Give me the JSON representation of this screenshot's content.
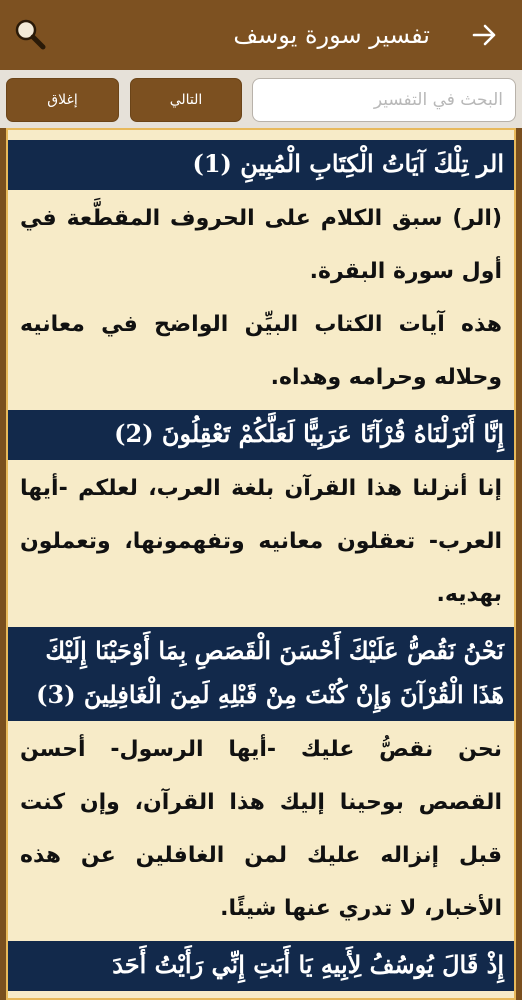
{
  "header": {
    "title": "تفسير سورة يوسف",
    "back_icon": "arrow-right-icon",
    "search_icon": "magnifier-icon",
    "background": "#7d5121"
  },
  "search": {
    "placeholder": "البحث في التفسير",
    "value": "",
    "next_label": "التالي",
    "close_label": "إغلاق"
  },
  "colors": {
    "verse_bg": "#12294b",
    "content_bg": "#f7ebc8",
    "border": "#e8b95b",
    "button_bg": "#7c5020"
  },
  "entries": [
    {
      "verse": "الر تِلْكَ آيَاتُ الْكِتَابِ الْمُبِينِ (1)",
      "tafsir": [
        "(الر) سبق الكلام على الحروف المقطَّعة في أول سورة البقرة.",
        "هذه آيات الكتاب البيِّن الواضح في معانيه وحلاله وحرامه وهداه."
      ]
    },
    {
      "verse": "إِنَّا أَنْزَلْنَاهُ قُرْآنًا عَرَبِيًّا لَعَلَّكُمْ تَعْقِلُونَ (2)",
      "tafsir": [
        "إنا أنزلنا هذا القرآن بلغة العرب، لعلكم -أيها العرب- تعقلون معانيه وتفهمونها، وتعملون بهديه."
      ]
    },
    {
      "verse": "نَحْنُ نَقُصُّ عَلَيْكَ أَحْسَنَ الْقَصَصِ بِمَا أَوْحَيْنَا إِلَيْكَ هَذَا الْقُرْآنَ وَإِنْ كُنْتَ مِنْ قَبْلِهِ لَمِنَ الْغَافِلِينَ (3)",
      "tafsir": [
        "نحن نقصُّ عليك -أيها الرسول- أحسن القصص بوحينا إليك هذا القرآن، وإن كنت قبل إنزاله عليك لمن الغافلين عن هذه الأخبار، لا تدري عنها شيئًا."
      ]
    },
    {
      "verse": "إِذْ قَالَ يُوسُفُ لِأَبِيهِ يَا أَبَتِ إِنِّي رَأَيْتُ أَحَدَ",
      "tafsir": []
    }
  ]
}
